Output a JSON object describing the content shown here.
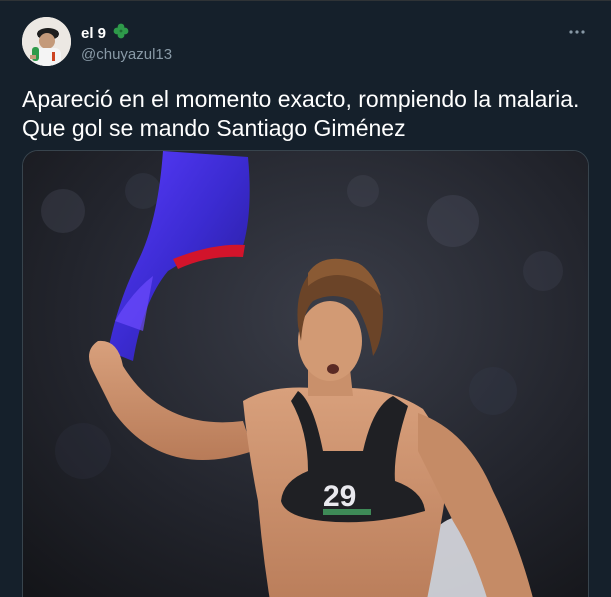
{
  "author": {
    "display_name": "el 9",
    "emoji_icon": "shamrock-icon",
    "handle": "@chuyazul13"
  },
  "tweet": {
    "text_lines": [
      "Apareció en el momento exacto, rompiendo la malaria.",
      "Que gol se mando Santiago Giménez"
    ],
    "media_icon": "photo-soccer-player-celebrating"
  },
  "jersey_number": "29",
  "colors": {
    "background": "#15202b",
    "secondary_text": "#8899a6",
    "shamrock": "#2e9a4a",
    "flag_blue": "#3b2bd1",
    "flag_red": "#d2142b"
  }
}
